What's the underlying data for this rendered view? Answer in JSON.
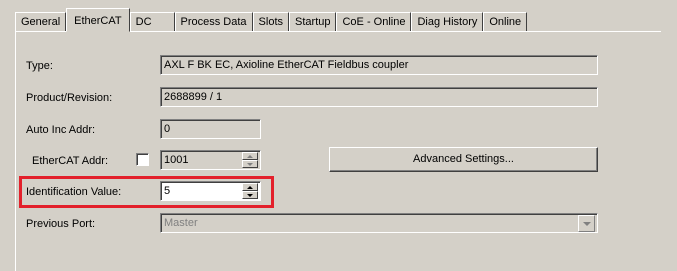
{
  "tabs": [
    {
      "label": "General"
    },
    {
      "label": "EtherCAT"
    },
    {
      "label": "DC"
    },
    {
      "label": "Process Data"
    },
    {
      "label": "Slots"
    },
    {
      "label": "Startup"
    },
    {
      "label": "CoE - Online"
    },
    {
      "label": "Diag History"
    },
    {
      "label": "Online"
    }
  ],
  "active_tab": "EtherCAT",
  "form": {
    "type": {
      "label": "Type:",
      "value": "AXL F BK EC, Axioline EtherCAT Fieldbus coupler"
    },
    "product_revision": {
      "label": "Product/Revision:",
      "value": "2688899 / 1"
    },
    "auto_inc_addr": {
      "label": "Auto Inc Addr:",
      "value": "0"
    },
    "ethercat_addr": {
      "label": "EtherCAT Addr:",
      "value": "1001",
      "checked": false
    },
    "identification_value": {
      "label": "Identification Value:",
      "value": "5"
    },
    "previous_port": {
      "label": "Previous Port:",
      "value": "Master"
    },
    "advanced_settings_label": "Advanced Settings..."
  },
  "colors": {
    "highlight": "#e3202b",
    "background": "#d4d0c8"
  }
}
